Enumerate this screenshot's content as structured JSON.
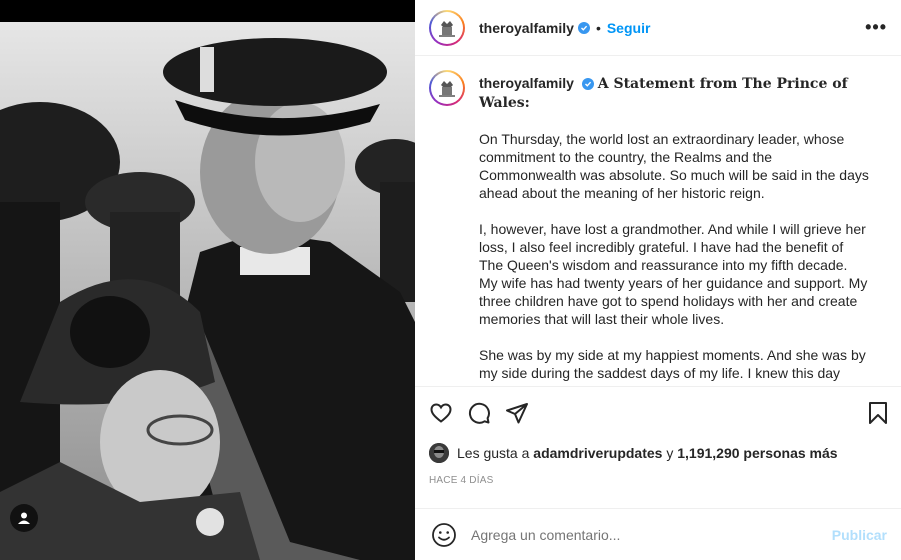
{
  "post": {
    "username": "theroyalfamily",
    "follow_label": "Seguir",
    "more_label": "•••",
    "separator": "•"
  },
  "caption": {
    "username": "theroyalfamily",
    "title": "A Statement from The Prince of Wales:",
    "paragraphs": [
      "On Thursday, the world lost an extraordinary leader, whose commitment to the country, the Realms and the Commonwealth was absolute. So much will be said in the days ahead about the meaning of her historic reign.",
      "I, however, have lost a grandmother. And while I will grieve her loss, I also feel incredibly grateful. I have had the benefit of The Queen's wisdom and reassurance into my fifth decade. My wife has had twenty years of her guidance and support. My three children have got to spend holidays with her and create memories that will last their whole lives.",
      "She was by my side at my happiest moments. And she was by my side during the saddest days of my life. I knew this day would come, but it will be some time before the reality of life without Grannie will truly feel real."
    ]
  },
  "likes": {
    "prefix": "Les gusta a",
    "user": "adamdriverupdates",
    "joiner": "y",
    "count": "1,191,290 personas más"
  },
  "timestamp": "HACE 4 DÍAS",
  "comment_box": {
    "placeholder": "Agrega un comentario...",
    "post_label": "Publicar"
  },
  "colors": {
    "accent": "#0095f6",
    "verified": "#3897f0",
    "muted": "#8e8e8e",
    "post_disabled": "#b2dffc"
  },
  "icons": {
    "like": "heart-icon",
    "comment": "comment-bubble-icon",
    "share": "paper-plane-icon",
    "save": "bookmark-icon",
    "emoji": "smiley-icon",
    "user_tag": "user-tag-icon",
    "more": "more-options-icon",
    "verified": "verified-badge-icon"
  }
}
